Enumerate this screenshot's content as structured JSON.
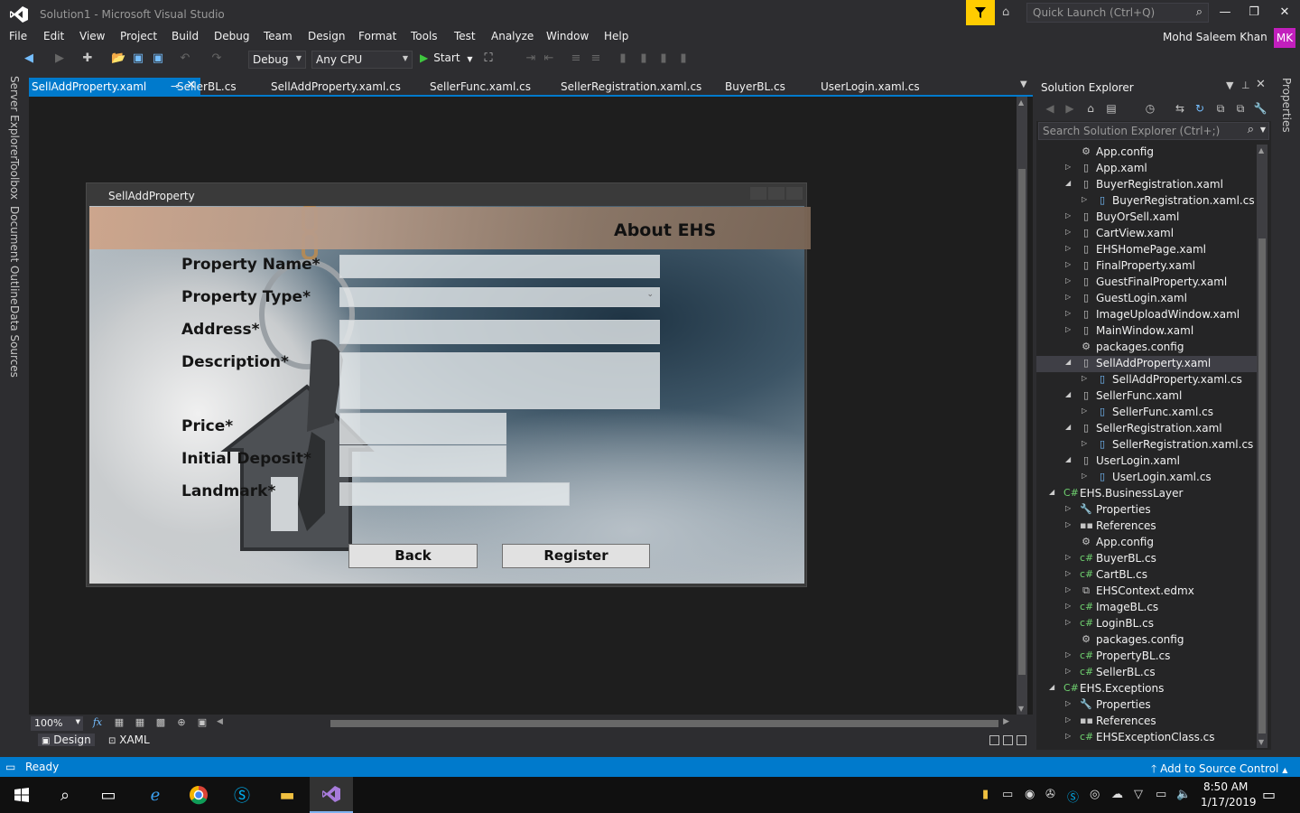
{
  "window": {
    "title": "Solution1 - Microsoft Visual Studio",
    "quick_launch_placeholder": "Quick Launch (Ctrl+Q)",
    "user_name": "Mohd Saleem Khan",
    "user_initials": "MK"
  },
  "menu": [
    "File",
    "Edit",
    "View",
    "Project",
    "Build",
    "Debug",
    "Team",
    "Design",
    "Format",
    "Tools",
    "Test",
    "Analyze",
    "Window",
    "Help"
  ],
  "toolbar": {
    "config": "Debug",
    "platform": "Any CPU",
    "start_label": "Start"
  },
  "left_rail": [
    "Server Explorer",
    "Toolbox",
    "Document Outline",
    "Data Sources"
  ],
  "tabs": [
    {
      "label": "SellAddProperty.xaml",
      "active": true
    },
    {
      "label": "SellerBL.cs",
      "active": false
    },
    {
      "label": "SellAddProperty.xaml.cs",
      "active": false
    },
    {
      "label": "SellerFunc.xaml.cs",
      "active": false
    },
    {
      "label": "SellerRegistration.xaml.cs",
      "active": false
    },
    {
      "label": "BuyerBL.cs",
      "active": false
    },
    {
      "label": "UserLogin.xaml.cs",
      "active": false
    }
  ],
  "designer": {
    "window_title": "SellAddProperty",
    "banner_title": "About EHS",
    "fields": {
      "property_name": "Property Name*",
      "property_type": "Property Type*",
      "address": "Address*",
      "description": "Description*",
      "price": "Price*",
      "initial_deposit": "Initial Deposit*",
      "landmark": "Landmark*"
    },
    "back_button": "Back",
    "register_button": "Register",
    "zoom": "100%",
    "view_design": "Design",
    "view_xaml": "XAML",
    "fx_label": "fx"
  },
  "solution_explorer": {
    "title": "Solution Explorer",
    "search_placeholder": "Search Solution Explorer (Ctrl+;)",
    "items": [
      {
        "label": "App.config",
        "indent": 1,
        "expander": "",
        "icon": "config"
      },
      {
        "label": "App.xaml",
        "indent": 1,
        "expander": "closed",
        "icon": "xaml"
      },
      {
        "label": "BuyerRegistration.xaml",
        "indent": 1,
        "expander": "open",
        "icon": "xaml"
      },
      {
        "label": "BuyerRegistration.xaml.cs",
        "indent": 2,
        "expander": "closed",
        "icon": "xamlcs"
      },
      {
        "label": "BuyOrSell.xaml",
        "indent": 1,
        "expander": "closed",
        "icon": "xaml"
      },
      {
        "label": "CartView.xaml",
        "indent": 1,
        "expander": "closed",
        "icon": "xaml"
      },
      {
        "label": "EHSHomePage.xaml",
        "indent": 1,
        "expander": "closed",
        "icon": "xaml"
      },
      {
        "label": "FinalProperty.xaml",
        "indent": 1,
        "expander": "closed",
        "icon": "xaml"
      },
      {
        "label": "GuestFinalProperty.xaml",
        "indent": 1,
        "expander": "closed",
        "icon": "xaml"
      },
      {
        "label": "GuestLogin.xaml",
        "indent": 1,
        "expander": "closed",
        "icon": "xaml"
      },
      {
        "label": "ImageUploadWindow.xaml",
        "indent": 1,
        "expander": "closed",
        "icon": "xaml"
      },
      {
        "label": "MainWindow.xaml",
        "indent": 1,
        "expander": "closed",
        "icon": "xaml"
      },
      {
        "label": "packages.config",
        "indent": 1,
        "expander": "",
        "icon": "config"
      },
      {
        "label": "SellAddProperty.xaml",
        "indent": 1,
        "expander": "open",
        "icon": "xaml",
        "selected": true
      },
      {
        "label": "SellAddProperty.xaml.cs",
        "indent": 2,
        "expander": "closed",
        "icon": "xamlcs"
      },
      {
        "label": "SellerFunc.xaml",
        "indent": 1,
        "expander": "open",
        "icon": "xaml"
      },
      {
        "label": "SellerFunc.xaml.cs",
        "indent": 2,
        "expander": "closed",
        "icon": "xamlcs"
      },
      {
        "label": "SellerRegistration.xaml",
        "indent": 1,
        "expander": "open",
        "icon": "xaml"
      },
      {
        "label": "SellerRegistration.xaml.cs",
        "indent": 2,
        "expander": "closed",
        "icon": "xamlcs"
      },
      {
        "label": "UserLogin.xaml",
        "indent": 1,
        "expander": "open",
        "icon": "xaml"
      },
      {
        "label": "UserLogin.xaml.cs",
        "indent": 2,
        "expander": "closed",
        "icon": "xamlcs"
      },
      {
        "label": "EHS.BusinessLayer",
        "indent": 0,
        "expander": "open",
        "icon": "csproj"
      },
      {
        "label": "Properties",
        "indent": 1,
        "expander": "closed",
        "icon": "wrench"
      },
      {
        "label": "References",
        "indent": 1,
        "expander": "closed",
        "icon": "refs"
      },
      {
        "label": "App.config",
        "indent": 1,
        "expander": "",
        "icon": "config"
      },
      {
        "label": "BuyerBL.cs",
        "indent": 1,
        "expander": "closed",
        "icon": "cs"
      },
      {
        "label": "CartBL.cs",
        "indent": 1,
        "expander": "closed",
        "icon": "cs"
      },
      {
        "label": "EHSContext.edmx",
        "indent": 1,
        "expander": "closed",
        "icon": "edmx"
      },
      {
        "label": "ImageBL.cs",
        "indent": 1,
        "expander": "closed",
        "icon": "cs"
      },
      {
        "label": "LoginBL.cs",
        "indent": 1,
        "expander": "closed",
        "icon": "cs"
      },
      {
        "label": "packages.config",
        "indent": 1,
        "expander": "",
        "icon": "config"
      },
      {
        "label": "PropertyBL.cs",
        "indent": 1,
        "expander": "closed",
        "icon": "cs"
      },
      {
        "label": "SellerBL.cs",
        "indent": 1,
        "expander": "closed",
        "icon": "cs"
      },
      {
        "label": "EHS.Exceptions",
        "indent": 0,
        "expander": "open",
        "icon": "csproj"
      },
      {
        "label": "Properties",
        "indent": 1,
        "expander": "closed",
        "icon": "wrench"
      },
      {
        "label": "References",
        "indent": 1,
        "expander": "closed",
        "icon": "refs"
      },
      {
        "label": "EHSExceptionClass.cs",
        "indent": 1,
        "expander": "closed",
        "icon": "cs"
      }
    ]
  },
  "properties_rail": "Properties",
  "status": {
    "text": "Ready",
    "source_control": "Add to Source Control"
  },
  "taskbar": {
    "time": "8:50 AM",
    "date": "1/17/2019"
  },
  "colors": {
    "accent": "#007acc",
    "background": "#2d2d30",
    "designer_bg": "#1e1e1e",
    "filter_yellow": "#ffcc00",
    "avatar": "#c21fbd",
    "cs_icon": "#6fd16f"
  }
}
